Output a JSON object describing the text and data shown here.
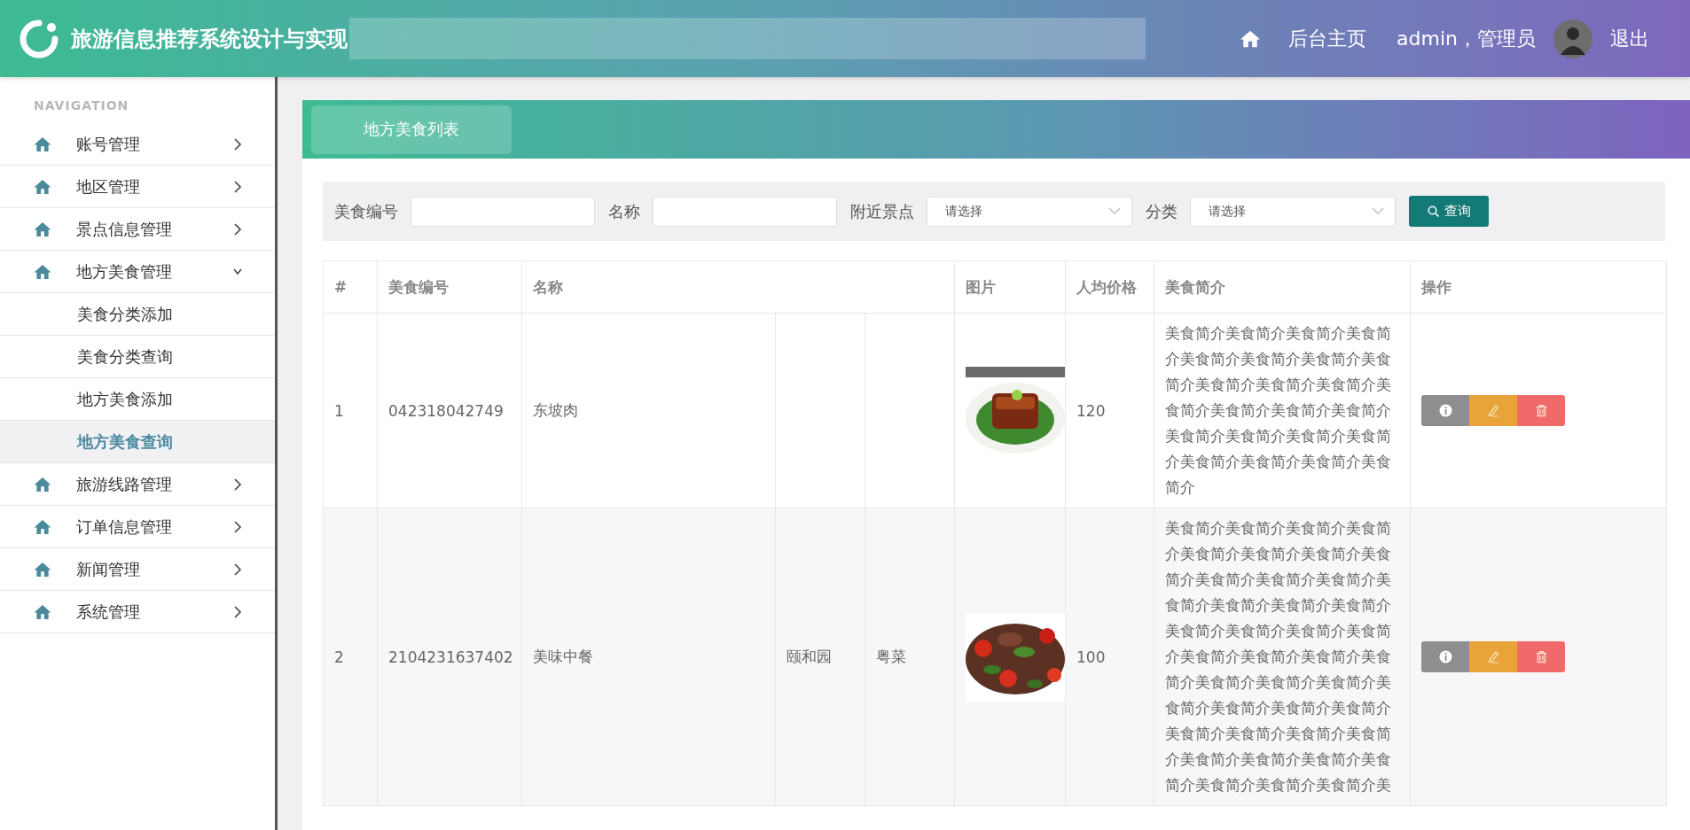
{
  "header": {
    "title": "旅游信息推荐系统设计与实现",
    "home_link": "后台主页",
    "user": "admin，管理员",
    "logout": "退出"
  },
  "sidebar": {
    "heading": "NAVIGATION",
    "items": [
      {
        "label": "账号管理",
        "expanded": false
      },
      {
        "label": "地区管理",
        "expanded": false
      },
      {
        "label": "景点信息管理",
        "expanded": false
      },
      {
        "label": "地方美食管理",
        "expanded": true,
        "children": [
          {
            "label": "美食分类添加",
            "selected": false
          },
          {
            "label": "美食分类查询",
            "selected": false
          },
          {
            "label": "地方美食添加",
            "selected": false
          },
          {
            "label": "地方美食查询",
            "selected": true
          }
        ]
      },
      {
        "label": "旅游线路管理",
        "expanded": false
      },
      {
        "label": "订单信息管理",
        "expanded": false
      },
      {
        "label": "新闻管理",
        "expanded": false
      },
      {
        "label": "系统管理",
        "expanded": false
      }
    ]
  },
  "panel": {
    "tab": "地方美食列表"
  },
  "filters": [
    {
      "kind": "text",
      "label": "美食编号"
    },
    {
      "kind": "text",
      "label": "名称"
    },
    {
      "kind": "select",
      "label": "附近景点",
      "placeholder": "请选择"
    },
    {
      "kind": "select",
      "label": "分类",
      "placeholder": "请选择"
    }
  ],
  "search_button": "查询",
  "table": {
    "columns": {
      "index": "#",
      "code": "美食编号",
      "name": "名称",
      "image": "图片",
      "price": "人均价格",
      "description": "美食简介",
      "actions": "操作"
    },
    "rows": [
      {
        "index": "1",
        "code": "042318042749",
        "name": "东坡肉",
        "price": "120",
        "description": "美食简介美食简介美食简介美食简介美食简介美食简介美食简介美食简介美食简介美食简介美食简介美食简介美食简介美食简介美食简介美食简介美食简介美食简介美食简介美食简介美食简介美食简介美食简介"
      },
      {
        "index": "2",
        "code": "2104231637402",
        "name": "美味中餐",
        "column_4": "颐和园",
        "column_5": "粤菜",
        "price": "100",
        "description": "美食简介美食简介美食简介美食简介美食简介美食简介美食简介美食简介美食简介美食简介美食简介美食简介美食简介美食简介美食简介美食简介美食简介美食简介美食简介美食简介美食简介美食简介美食简介美食简介美食简介美食简介美食简介美食简介美食简介美食简介美食简介美食简介美食简介美食简介美食简介美食简介美食简介美食简介美食简介美食简介美食简介美"
      }
    ]
  }
}
